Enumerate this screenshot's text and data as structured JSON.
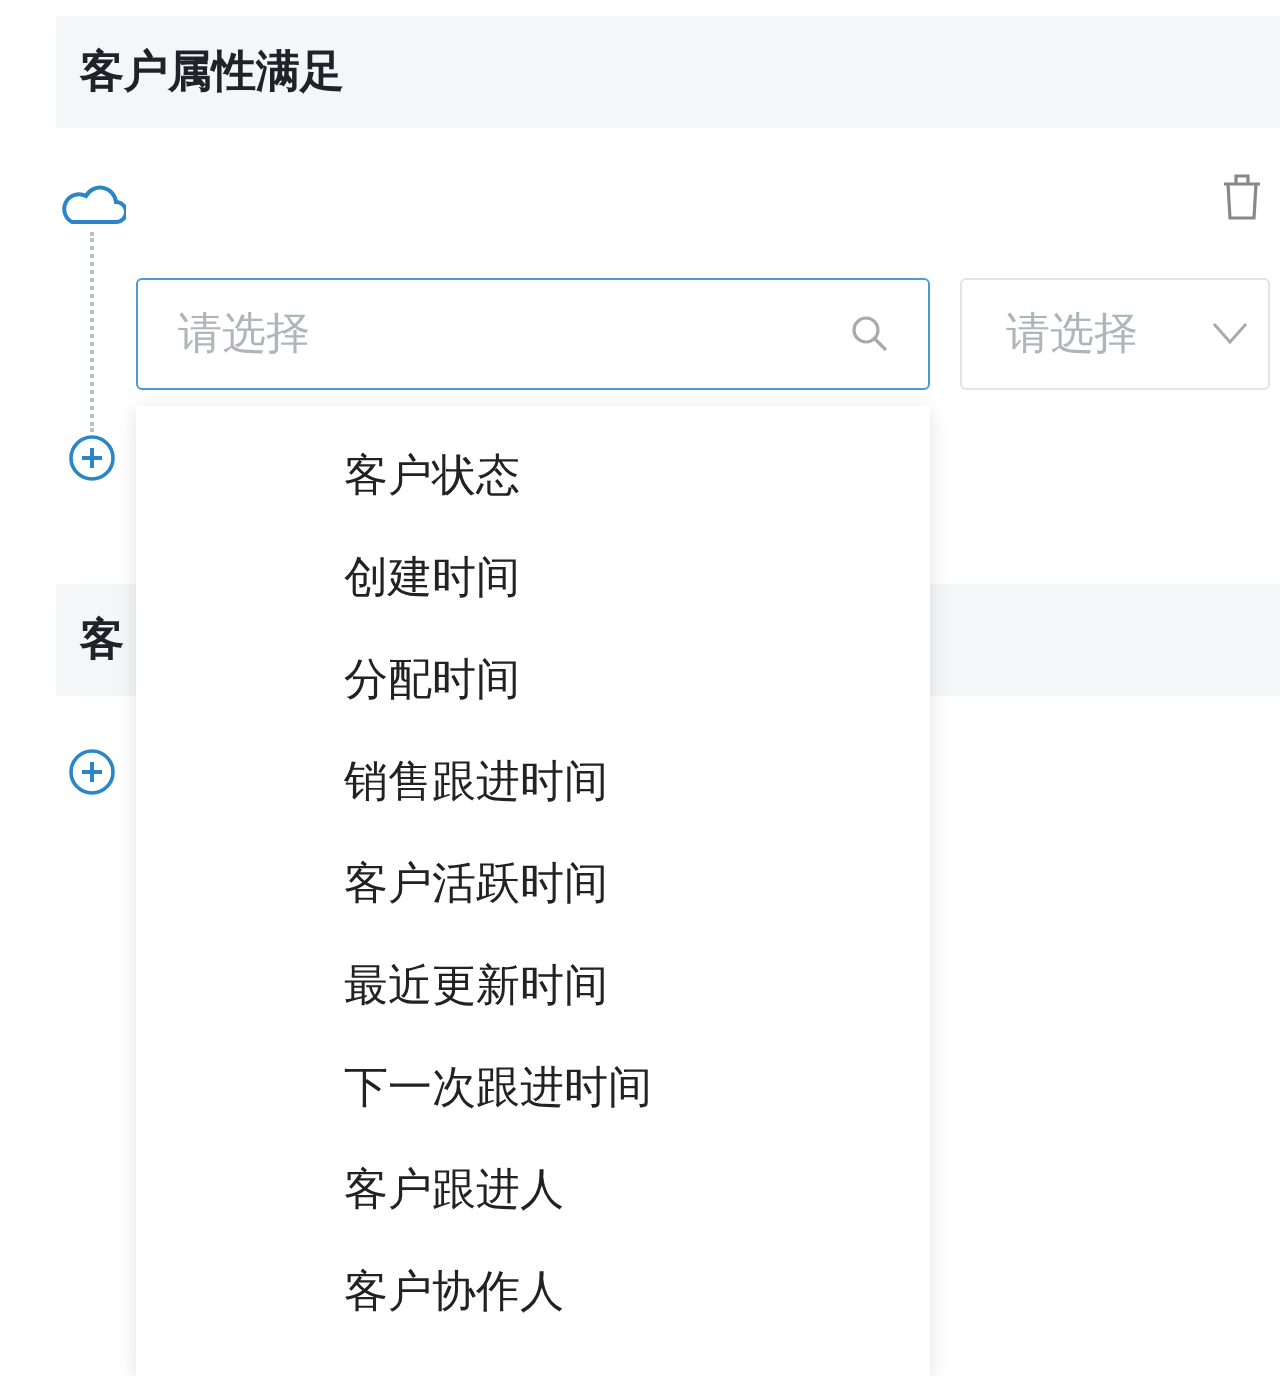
{
  "sections": [
    {
      "title": "客户属性满足"
    },
    {
      "title": "客"
    }
  ],
  "condition": {
    "field": {
      "placeholder": "请选择",
      "focused": true
    },
    "operator": {
      "placeholder": "请选择"
    }
  },
  "dropdown": {
    "options": [
      {
        "label": "客户状态"
      },
      {
        "label": "创建时间"
      },
      {
        "label": "分配时间"
      },
      {
        "label": "销售跟进时间"
      },
      {
        "label": "客户活跃时间"
      },
      {
        "label": "最近更新时间"
      },
      {
        "label": "下一次跟进时间"
      },
      {
        "label": "客户跟进人"
      },
      {
        "label": "客户协作人"
      }
    ]
  }
}
